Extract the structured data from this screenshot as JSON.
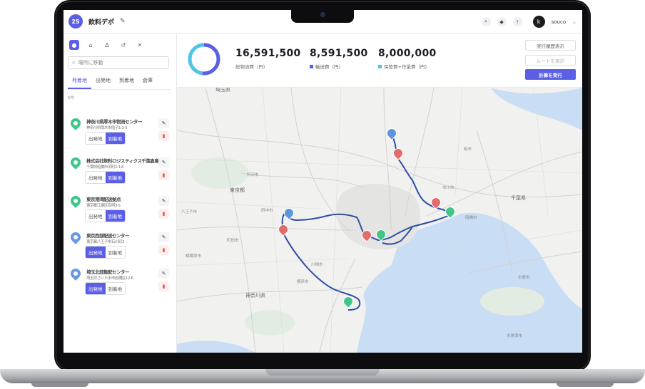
{
  "header": {
    "workspace_badge": "2S",
    "workspace_name": "飲料デポ",
    "user_initial": "k",
    "user_name": "souco"
  },
  "sidebar": {
    "search_placeholder": "場所に移動",
    "tabs": [
      "発着地",
      "出発地",
      "到着地",
      "倉庫"
    ],
    "count_label": "5件",
    "locations": [
      {
        "name": "神奈川県厚木市物流センター",
        "addr": "神奈川県厚木市船子1-2-3",
        "origin_label": "出発地",
        "dest_label": "到着地",
        "selected": "到着地",
        "pin": "green"
      },
      {
        "name": "株式会社飲料ロジスティクス千葉倉庫",
        "addr": "千葉県船橋市浜町2-1-8",
        "origin_label": "出発地",
        "dest_label": "到着地",
        "selected": "到着地",
        "pin": "green"
      },
      {
        "name": "東京港湾配送拠点",
        "addr": "東京都江東区有明3-5",
        "origin_label": "出発地",
        "dest_label": "到着地",
        "selected": "到着地",
        "pin": "green"
      },
      {
        "name": "東京西部配送センター",
        "addr": "東京都八王子市石川町2",
        "origin_label": "出発地",
        "dest_label": "到着地",
        "selected": "出発地",
        "pin": "blue"
      },
      {
        "name": "埼玉北部集配センター",
        "addr": "埼玉県さいたま市岩槻区12-6",
        "origin_label": "出発地",
        "dest_label": "到着地",
        "selected": "出発地",
        "pin": "blue"
      }
    ]
  },
  "stats": {
    "total_value": "16,591,500",
    "total_label": "総物流費（円）",
    "transport_value": "8,591,500",
    "transport_label": "輸送費（円）",
    "storage_value": "8,000,000",
    "storage_label": "保管費+作業費（円）",
    "donut_split": {
      "transport": 8591500,
      "storage": 8000000
    },
    "colors": {
      "transport": "#5b5fe6",
      "storage": "#4fc3e8"
    }
  },
  "actions": {
    "history_label": "実行履歴表示",
    "route_label": "ルートを表示",
    "run_label": "計算を実行"
  },
  "map": {
    "labels": {
      "saitama": "埼玉県",
      "tokyo": "東京都",
      "kanagawa": "神奈川県",
      "chiba": "千葉県",
      "kawasaki": "川崎市",
      "yokohama": "横浜市",
      "sagamihara": "相模原市",
      "hachioji": "八王子市",
      "machida": "町田市",
      "funabashi": "船橋市",
      "ichikawa": "市川市",
      "kisarazu": "木更津市",
      "ichihara": "市原市",
      "kashiwa": "柏市",
      "tokorozawa": "所沢市",
      "fuchu": "府中市"
    }
  }
}
